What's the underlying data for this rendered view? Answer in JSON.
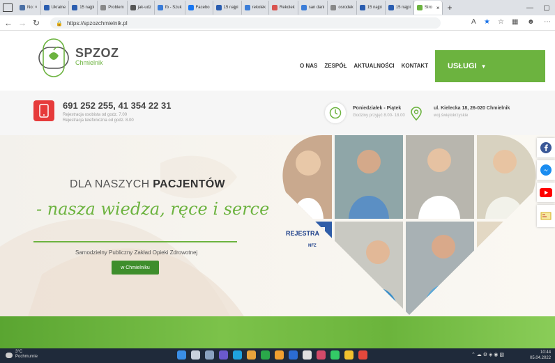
{
  "browser": {
    "tabs": [
      {
        "label": "No: ×",
        "color": "#4a6fa5"
      },
      {
        "label": "Ukraine",
        "color": "#2a5db0"
      },
      {
        "label": "15 najpi",
        "color": "#2a5db0"
      },
      {
        "label": "Problem",
        "color": "#888888"
      },
      {
        "label": "jak-udz",
        "color": "#555555"
      },
      {
        "label": "fb - Szuk",
        "color": "#3b7dd8"
      },
      {
        "label": "Facebo",
        "color": "#1877f2"
      },
      {
        "label": "15 najpi",
        "color": "#2a5db0"
      },
      {
        "label": "rekolek",
        "color": "#3b7dd8"
      },
      {
        "label": "Rekolek",
        "color": "#d9534f"
      },
      {
        "label": "san dani",
        "color": "#3b7dd8"
      },
      {
        "label": "osrodek",
        "color": "#888888"
      },
      {
        "label": "15 najpi",
        "color": "#2a5db0"
      },
      {
        "label": "15 najpi",
        "color": "#2a5db0"
      }
    ],
    "active_tab": {
      "label": "Stro",
      "close": "×"
    },
    "new_tab": "+",
    "url": "https://spzozchmielnik.pl"
  },
  "site": {
    "logo_title": "SPZOZ",
    "logo_sub": "Chmielnik",
    "nav": [
      "O NAS",
      "ZESPÓŁ",
      "AKTUALNOŚCI",
      "KONTAKT"
    ],
    "services_button": "USŁUGI",
    "phone": "691 252 255, 41 354 22 31",
    "reg1": "Rejestracja osobista od godz. 7.00",
    "reg2": "Rejestracja telefoniczna od godz. 8.00",
    "hours_title": "Poniedziałek - Piątek",
    "hours_sub": "Godziny przyjęć 8.00- 18.00",
    "address_title": "ul. Kielecka 18, 26-020 Chmielnik",
    "address_sub": "woj.świętokrzyskie",
    "hero_pre": "DLA NASZYCH ",
    "hero_bold": "PACJENTÓW",
    "hero_slogan": "- nasza wiedza, ręce i serce",
    "hero_desc": "Samodzielny Publiczny Zakład Opieki Zdrowotnej",
    "hero_button": "w Chmielniku",
    "sign_text": "REJESTRA",
    "nfz": "NFZ"
  },
  "taskbar": {
    "weather_temp": "3°C",
    "weather_desc": "Pochmurnie",
    "time": "10:44",
    "date": "05.04.2022"
  },
  "colors": {
    "brand_green": "#6cb33f",
    "phone_red": "#e63b3b",
    "facebook": "#3b5998",
    "youtube": "#ff0000"
  }
}
